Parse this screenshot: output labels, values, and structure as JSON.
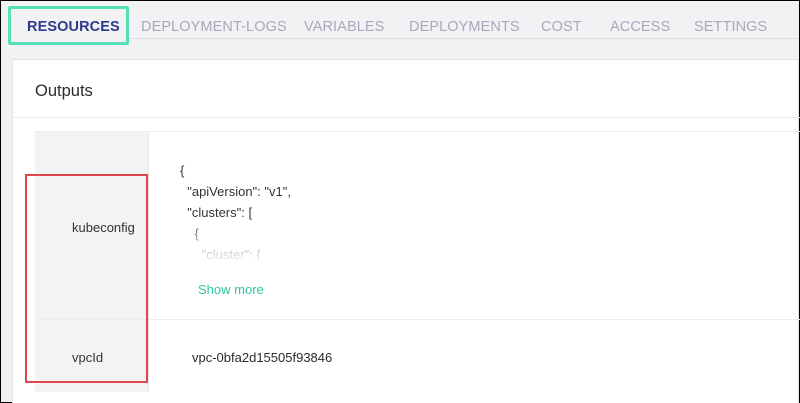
{
  "tabs": [
    {
      "label": "RESOURCES",
      "active": true
    },
    {
      "label": "DEPLOYMENT-LOGS",
      "active": false
    },
    {
      "label": "VARIABLES",
      "active": false
    },
    {
      "label": "DEPLOYMENTS",
      "active": false
    },
    {
      "label": "COST",
      "active": false
    },
    {
      "label": "ACCESS",
      "active": false
    },
    {
      "label": "SETTINGS",
      "active": false
    }
  ],
  "outputs": {
    "title": "Outputs",
    "rows": [
      {
        "key": "kubeconfig",
        "value_preview": "{\n  \"apiVersion\": \"v1\",\n  \"clusters\": [\n    {\n      \"cluster\": {",
        "show_more": "Show more"
      },
      {
        "key": "vpcId",
        "value": "vpc-0bfa2d15505f93846"
      }
    ]
  },
  "colors": {
    "active_tab": "#2d3a8c",
    "inactive_tab": "#a6a9bb",
    "tab_highlight": "#56e0b5",
    "link": "#2ec6a1",
    "annotation": "#e0464b"
  }
}
